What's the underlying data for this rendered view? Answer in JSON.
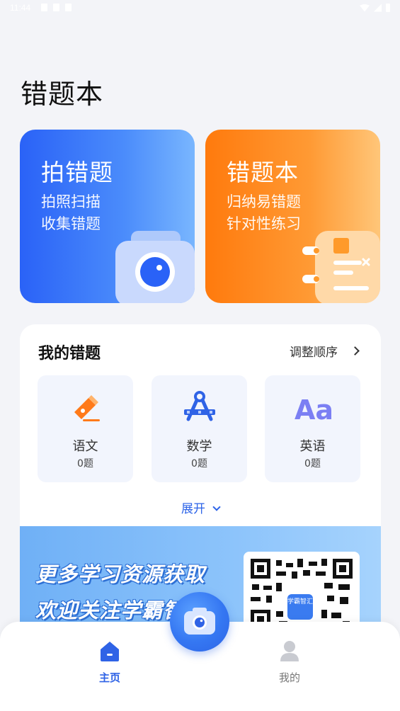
{
  "status_bar": {
    "time": "11:44"
  },
  "page": {
    "title": "错题本"
  },
  "cards": {
    "capture": {
      "title": "拍错题",
      "line1": "拍照扫描",
      "line2": "收集错题"
    },
    "book": {
      "title": "错题本",
      "line1": "归纳易错题",
      "line2": "针对性练习"
    }
  },
  "my_mistakes": {
    "title": "我的错题",
    "reorder_label": "调整顺序",
    "subjects": [
      {
        "name": "语文",
        "count": "0题",
        "icon": "pen-icon"
      },
      {
        "name": "数学",
        "count": "0题",
        "icon": "compass-icon"
      },
      {
        "name": "英语",
        "count": "0题",
        "icon": "text-aa-icon"
      }
    ],
    "expand_label": "展开"
  },
  "banner": {
    "line1": "更多学习资源获取",
    "line2": "欢迎关注学霸智汇",
    "qr_badge": "学霸智汇"
  },
  "bottom_nav": {
    "home_label": "主页",
    "mine_label": "我的"
  },
  "colors": {
    "primary": "#2f63e6",
    "capture_card": "#2a62f7",
    "book_card": "#ff7a0d",
    "page_bg": "#f3f4f8"
  }
}
